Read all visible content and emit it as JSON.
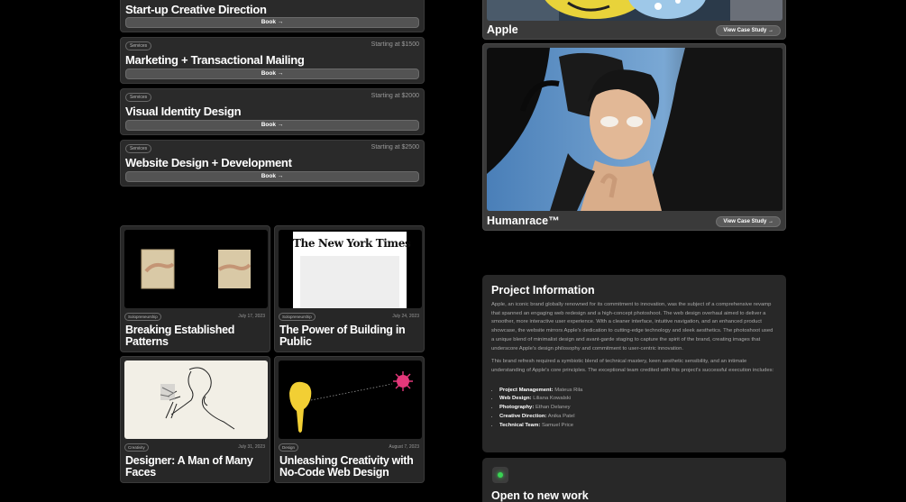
{
  "services": [
    {
      "tag": "",
      "title": "Start-up Creative Direction",
      "price": "",
      "button": "Book →"
    },
    {
      "tag": "Services",
      "title": "Marketing + Transactional Mailing",
      "price": "Starting at $1500",
      "button": "Book →"
    },
    {
      "tag": "Services",
      "title": "Visual Identity Design",
      "price": "Starting at $2000",
      "button": "Book →"
    },
    {
      "tag": "Services",
      "title": "Website Design + Development",
      "price": "Starting at $2500",
      "button": "Book →"
    }
  ],
  "blog": [
    {
      "tag": "Solopreneurship",
      "date": "July 17, 2023",
      "title": "Breaking Established Patterns"
    },
    {
      "tag": "Solopreneurship",
      "date": "July 24, 2023",
      "title": "The Power of Building in Public",
      "masthead": "The New York Times"
    },
    {
      "tag": "Creativity",
      "date": "July 31, 2023",
      "title": "Designer: A Man of Many Faces"
    },
    {
      "tag": "Design",
      "date": "August 7, 2023",
      "title": "Unleashing Creativity with No-Code Web Design"
    }
  ],
  "cases": [
    {
      "name": "Apple",
      "button": "View Case Study"
    },
    {
      "name": "Humanrace™",
      "button": "View Case Study"
    }
  ],
  "project": {
    "title": "Project Information",
    "p1": "Apple, an iconic brand globally renowned for its commitment to innovation, was the subject of a comprehensive revamp that spanned an engaging web redesign and a high-concept photoshoot. The web design overhaul aimed to deliver a smoother, more interactive user experience. With a cleaner interface, intuitive navigation, and an enhanced product showcase, the website mirrors Apple's dedication to cutting-edge technology and sleek aesthetics. The photoshoot used a unique blend of minimalist design and avant-garde staging to capture the spirit of the brand, creating images that underscore Apple's design philosophy and commitment to user-centric innovation.",
    "p2": "This brand refresh required a symbiotic blend of technical mastery, keen aesthetic sensibility, and an intimate understanding of Apple's core principles. The exceptional team credited with this project's successful execution includes:",
    "credits": [
      {
        "role": "Project Management:",
        "name": "Mateus Rila"
      },
      {
        "role": "Web Design:",
        "name": "Liliana Kowalski"
      },
      {
        "role": "Photography:",
        "name": "Ethan Delaney"
      },
      {
        "role": "Creative Direction:",
        "name": "Anika Patel"
      },
      {
        "role": "Technical Team:",
        "name": "Samuel Price"
      }
    ]
  },
  "status": {
    "title": "Open to new work",
    "dot_color": "#39d353"
  }
}
